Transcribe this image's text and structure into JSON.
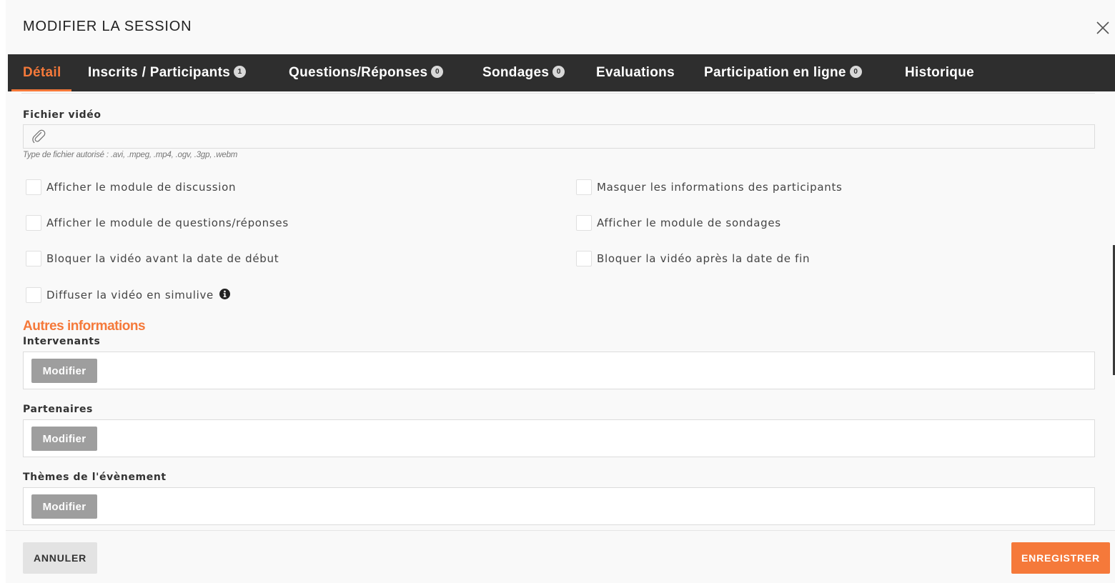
{
  "header": {
    "title": "MODIFIER LA SESSION",
    "close_icon": "close-icon"
  },
  "tabs": [
    {
      "label": "Détail",
      "active": true
    },
    {
      "label": "Inscrits / Participants",
      "count": "1"
    },
    {
      "label": "Questions/Réponses",
      "count": "0"
    },
    {
      "label": "Sondages",
      "count": "0"
    },
    {
      "label": "Evaluations"
    },
    {
      "label": "Participation en ligne",
      "count": "0"
    },
    {
      "label": "Historique"
    }
  ],
  "video": {
    "label": "Fichier vidéo",
    "icon": "paperclip-icon",
    "hint": "Type de fichier autorisé : .avi, .mpeg, .mp4, .ogv, .3gp, .webm"
  },
  "options": {
    "show_chat": "Afficher le module de discussion",
    "hide_participant_info": "Masquer les informations des participants",
    "show_qa": "Afficher le module de questions/réponses",
    "show_polls": "Afficher le module de sondages",
    "block_before_start": "Bloquer la vidéo avant la date de début",
    "block_after_end": "Bloquer la vidéo après la date de fin",
    "simulive": "Diffuser la vidéo en simulive",
    "simulive_icon": "info-icon",
    "checked": {
      "show_chat": false,
      "hide_participant_info": false,
      "show_qa": false,
      "show_polls": false,
      "block_before_start": false,
      "block_after_end": false,
      "simulive": false
    }
  },
  "other": {
    "title": "Autres informations",
    "speakers_label": "Intervenants",
    "partners_label": "Partenaires",
    "themes_label": "Thèmes de l'évènement",
    "modify_label": "Modifier"
  },
  "footer": {
    "cancel_label": "ANNULER",
    "save_label": "ENREGISTRER"
  },
  "colors": {
    "accent": "#f5793a",
    "tabbar_bg": "#2e2e2e",
    "modify_button": "#9e9e9e"
  }
}
